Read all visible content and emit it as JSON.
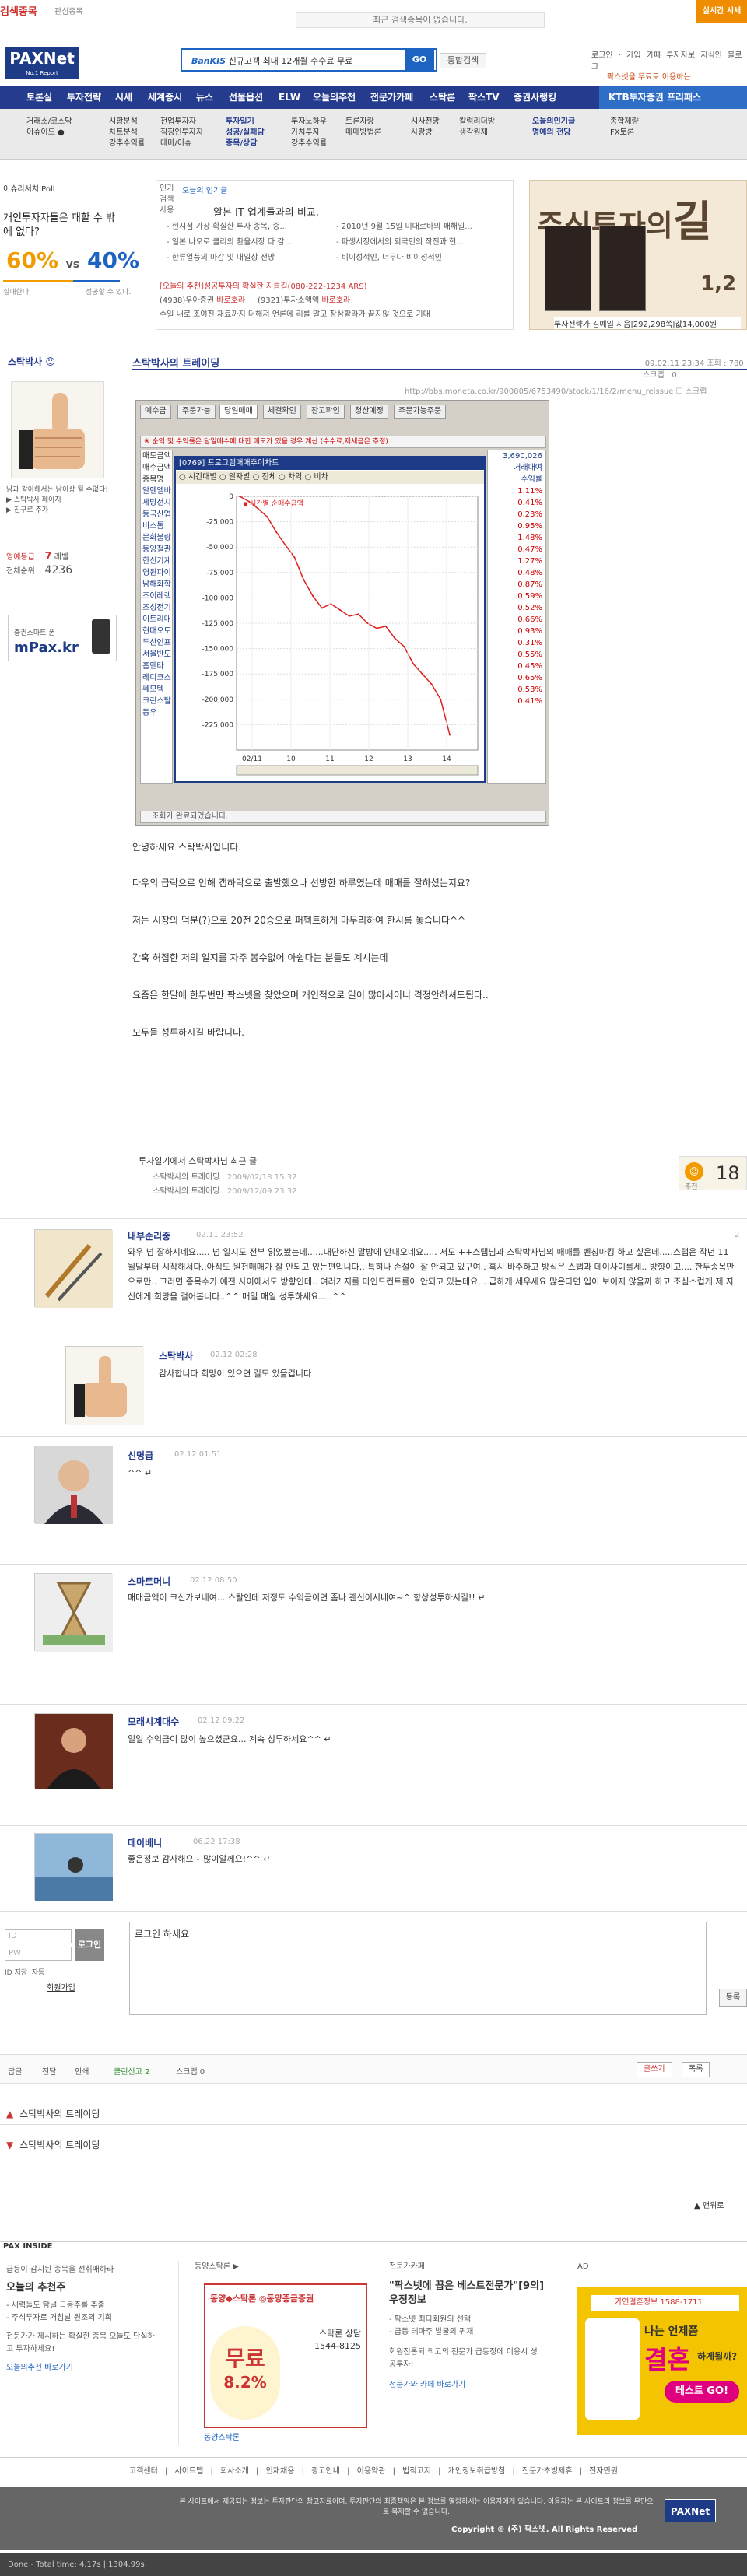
{
  "topbar": {
    "search_label": "검색종목",
    "search_sub": "관심종목",
    "notice": "최근 검색종목이 없습니다.",
    "cta": "실시간 시세"
  },
  "header": {
    "logo": "PAXNet",
    "logo_sub": "No.1 Report",
    "ad_brand": "BanKIS",
    "ad_text": "신규고객 최대 12개월 수수료 무료",
    "ad_go": "GO",
    "ad_btn": "통합검색",
    "util": "로그인 · 가입 카페 투자자보 지식인 블로그",
    "ktb_small": "팍스넷을 무료로 이용하는"
  },
  "nav": {
    "items": [
      "토론실",
      "투자전략",
      "시세",
      "세계증시",
      "뉴스",
      "선물옵션",
      "ELW",
      "오늘의추천",
      "전문가카페",
      "스탁론",
      "팍스TV",
      "증권사랭킹"
    ],
    "ktb": "KTB투자증권 프리패스"
  },
  "subnav": [
    {
      "lines": [
        "거래소/코스닥",
        "이슈이드 ●"
      ],
      "hl": false
    },
    {
      "lines": [
        "시황분석",
        "차트분석",
        "강추수익률"
      ],
      "hl": false
    },
    {
      "lines": [
        "전업투자자",
        "직장인투자자",
        "테마/이슈"
      ],
      "hl": false
    },
    {
      "lines": [
        "투자일기",
        "성공/실패담",
        "종목/상담"
      ],
      "hl": true
    },
    {
      "lines": [
        "투자노하우",
        "가치투자",
        "강추수익률"
      ],
      "hl": false
    },
    {
      "lines": [
        "토론자랑",
        "매매방법론"
      ],
      "hl": false
    },
    {
      "lines": [
        "시사전망",
        "사랑방"
      ],
      "hl": false
    },
    {
      "lines": [
        "칼럼리더방",
        "생각원제"
      ],
      "hl": false
    },
    {
      "lines": [
        "오늘의인기글",
        "명예의 전당"
      ],
      "hl": true
    },
    {
      "lines": [
        "종합제량",
        "FX토론"
      ],
      "hl": false
    }
  ],
  "poll": {
    "title": "이슈리서치 Poll",
    "question": "개인투자자들은 패할 수 밖에 없다?",
    "yes": "60%",
    "vs": "vs",
    "no": "40%",
    "yes_label": "실패한다.",
    "no_label": "성공할 수 있다."
  },
  "popular": {
    "side_label": "인기 검색 사용",
    "head": "오늘의 인기글",
    "title": "알본 IT 업계들과의 비교,",
    "list_left": [
      "- 현시점 가장 확실한 투자 종목, 중...",
      "- 일본 나오로 클리의 환율시장 다 감...",
      "- 한류열풍의 마감 및 내일장 전망"
    ],
    "list_right": [
      "- 2010년 9월 15일 미대르바의 패해일...",
      "- 파생시장에서의 외국인의 작전과 현...",
      "- 비이성적인, 너무나 비이성적인"
    ],
    "foot1": "[오늘의 추천]성공투자의 확실한 지름길(080-222-1234 ARS)",
    "foot2a": "(4938)우아증권",
    "foot2b": "바로호라",
    "foot2c": "(9321)투자소액액",
    "foot2d": "바로호라",
    "foot3": "수일 내로 조여진 재료까지 더해져 언론에 리를 알고 장삼활라가 끝지않 것으로 기대"
  },
  "book": {
    "title_a": "주식투자의",
    "title_b": "길",
    "vol": "1,2",
    "caption": "투자전략가 김예일 지음|292,298쪽|값14,000원"
  },
  "sidebar": {
    "name": "스탁박사 ☺",
    "desc": "남과 같아해서는 남이상 될 수없다!",
    "link1": "▶ 스탁박사 페이지",
    "link2": "▶ 친구로 추가",
    "level_label": "영예등급",
    "level_val": "7",
    "level_unit": "레벨",
    "count_label": "전체순위",
    "count_val": "4236",
    "mpax_t": "증권스마트 폰",
    "mpax_b": "mPax.kr"
  },
  "post": {
    "title": "스탁박사의 트레이딩",
    "date": "'09.02.11 23:34  조회 : 780  스크랩 : 0",
    "url": "http://bbs.moneta.co.kr/900805/6753490/stock/1/16/2/menu_reissue  ☐ 스크랩",
    "tabs": [
      "예수금",
      "주문가능",
      "당일매매",
      "체결확인",
      "잔고확인",
      "청산예정",
      "주문가능주문"
    ],
    "alert": "※ 순익 및 수익률은 당일매수에 대한 매도가 있을 경우 계산 (수수료,제세금은 추정)",
    "left_rows": [
      "매도금액",
      "매수금액",
      "종목명",
      "알엔엘바",
      "세방전지",
      "동국산업",
      "비스톰",
      "문화불랑",
      "동양철관",
      "한신기계",
      "영원파이",
      "남해화학",
      "조이레렉",
      "조성전기",
      "이트리매",
      "현대오토",
      "두산인프",
      "서울반도",
      "흡앤타",
      "레디코스",
      "쎄모텍",
      "크린스탈",
      "동우"
    ],
    "right_head": [
      "3,690,026",
      "거래대여",
      "수익률"
    ],
    "right_rows": [
      "1.11%",
      "0.41%",
      "0.23%",
      "0.95%",
      "1.48%",
      "0.47%",
      "1.27%",
      "0.48%",
      "0.87%",
      "0.59%",
      "0.52%",
      "0.66%",
      "0.93%",
      "0.31%",
      "0.55%",
      "0.45%",
      "0.65%",
      "0.53%",
      "0.41%"
    ],
    "chart_title": "[0769] 프로그램매매추이차트",
    "chart_radio": "○ 시간대별  ○ 일자별  ○ 전체  ○ 차익  ○ 비차",
    "footer": "조회가 완료되었습니다.",
    "paragraphs": [
      "안녕하세요 스탁박사입니다.",
      "다우의 급락으로 인해 갭하락으로 출발했으나 선방한 하루였는데 매매를 잘하셨는지요?",
      "저는 시장의 덕분(?)으로 20전 20승으로 퍼펙트하게 마무리하여 한시름 놓습니다^^",
      "간혹 허접한 저의 일지를 자주 봉수없어 아쉽다는 분들도 계시는데",
      "요즘은 한달에 한두번만 팍스넷을 찾았으며 개인적으로 일이 많아서이니 격정안하셔도됩다..",
      "모두들 성투하시길 바랍니다."
    ]
  },
  "chart_data": {
    "type": "line",
    "title": "시간별 순매수금액",
    "x": [
      "02/11",
      "10",
      "11",
      "12",
      "13",
      "14"
    ],
    "y_ticks": [
      "0",
      "-25,000",
      "-50,000",
      "-75,000",
      "-100,000",
      "-125,000",
      "-150,000",
      "-175,000",
      "-200,000",
      "-225,000"
    ],
    "ylim": [
      -250000,
      0
    ],
    "values": [
      0,
      -5000,
      -12000,
      -20000,
      -35000,
      -48000,
      -60000,
      -82000,
      -98000,
      -110000,
      -106000,
      -112000,
      -118000,
      -116000,
      -125000,
      -130000,
      -128000,
      -140000,
      -148000,
      -165000,
      -175000,
      -185000,
      -200000,
      -235000
    ]
  },
  "prev": {
    "title": "투자일기에서 스탁박사님 최근 글",
    "items": [
      {
        "t": "· 스탁박사의 트레이딩",
        "d": "2009/02/18 15:32"
      },
      {
        "t": "· 스탁박사의 트레이딩",
        "d": "2009/12/09 23:32"
      }
    ],
    "rec_label": "추천",
    "rec_val": "18"
  },
  "comments": [
    {
      "name": "내부순리중",
      "time": "02.11 23:52",
      "text": "와우 넘 잘하시네요..... 넘 일지도 전부 읽었봤는데......대단하신 말방에 안내오네요..... 저도 ++스탭님과 스탁박사님의 매매를 벤칭마킹 하고 싶은데.....스탭은 작년 11월달부터 시작해서다..아직도 원천매매가 잘 안되고 있는편입니다.. 특히나 손절이 잘 안되고 있구여.. 혹시 바주하고 방식은 스탭과 데이사이를세.. 방향이고.... 한두종목만으로만.. 그러면 종목수가 예전 사이에서도 방향인데.. 여러가지를 마인드컨트롤이 안되고 있는데요... 급하게 세우세요 많은다면 입이 보이지 않을까 하고 조심스럽게 제 자신에게 희망을 걸어봅니다..^^ 매일 매일 성투하세요.....^^",
      "reply": "2"
    },
    {
      "name": "스탁박사",
      "time": "02.12 02:28",
      "text": "감사합니다 희망이 있으면 길도 있을겁니다"
    },
    {
      "name": "신명급",
      "time": "02.12 01:51",
      "text": "^^ ↵"
    },
    {
      "name": "스마트머니",
      "time": "02.12 08:50",
      "text": "매매금액이 크신가보네여... 스탈인데 저정도 수익금이면 좀나 괜신이시네여~^ 항상성투하시길!!  ↵"
    },
    {
      "name": "모래시계대수",
      "time": "02.12 09:22",
      "text": "일일 수익금이 많이 높으셨군요... 계속 성투하세요^^  ↵"
    },
    {
      "name": "데이베니",
      "time": "06.22 17:38",
      "text": "좋은정보 감사해요~ 많이알께요!^^  ↵"
    }
  ],
  "login": {
    "id_ph": "ID",
    "pw_ph": "PW",
    "btn": "로그인",
    "opt1": "ID 저장",
    "opt2": "자동",
    "join": "회원가입"
  },
  "comment_box": {
    "text": "로그인 하세요",
    "reg": "등록"
  },
  "bottom_bar": {
    "items": [
      "답글",
      "전달",
      "인쇄",
      "클린신고 2",
      "스크랩 0"
    ],
    "right": [
      "글쓰기",
      "목록"
    ]
  },
  "nav_posts": [
    "스탁박사의 트레이딩",
    "스탁박사의 트레이딩"
  ],
  "top_link": "▲ 맨위로",
  "inside": {
    "label": "PAX INSIDE",
    "col1_sm": "급등이 감지된 종목을 선취매하라",
    "col1_big": "오늘의 추천주",
    "col1_list": [
      "- 세력들도 탐낼 급등주를 추출",
      "- 주식투자로 거침날 원조의 기회"
    ],
    "col1_tail": "전문가가 제시하는 확실한 종목 오늘도 단실하고 투자하세요!",
    "col1_link": "오늘의추천 바로가기",
    "col2_head": "동양스탁론 ▶",
    "promo_logo": "동양◆스탁론 ◎동양종금증권",
    "promo_free": "무료",
    "promo_rate": "8.2%",
    "promo_rt": "스탁론 상담 1544-8125",
    "col2_link": "동양스탁론",
    "col3_head": "전문가카페",
    "col3_big": "\"팍스넷에 꼽은 베스트전문가\"[9의]우정정보",
    "col3_list": [
      "- 팍스넷 최다회원의 선택",
      "- 급등 테마주 발굴의 귀재"
    ],
    "col3_tail": "회원전통되 최고의 전문가 급등정에 이용시 성공투자!",
    "col3_link": "전문가와 카페 바로가기",
    "ad_label": "AD",
    "ad2_logo": "가연결혼정보 1588-1711",
    "ad2_text": "나는 언제쯤",
    "ad2_big": "결혼",
    "ad2_tail": "하게될까?",
    "ad2_btn": "테스트 GO!"
  },
  "footer": {
    "links": "고객센터 | 사이트맵 | 회사소개 | 인재채용 | 광고안내 | 이용약관 | 법적고지 | 개인정보취급방침 | 전문가초빙제휴 | 전자민원",
    "text": "본 사이트에서 제공되는 정보는 투자판단의 참고자료이며, 투자판단의 최종책임은 본 정보를 열람하시는 이용자에게 있습니다. 이용자는 본 사이트의 정보를 무단으로 복제할 수 없습니다.",
    "copy": "Copyright © (주) 팍스넷. All Rights Reserved",
    "logo": "PAXNet"
  },
  "status": "Done - Total time: 4.17s | 1304.99s"
}
